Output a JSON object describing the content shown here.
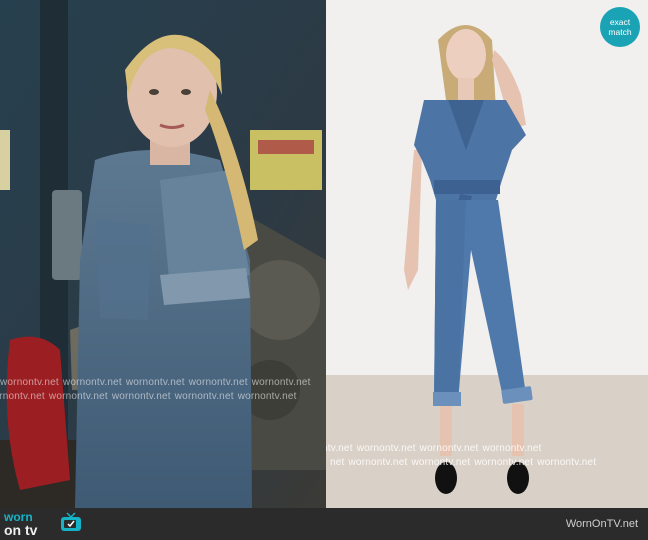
{
  "left_image": {
    "description": "Betty Cooper in denim jumpsuit with grey long-sleeve underneath, garage background"
  },
  "right_image": {
    "description": "Model wearing short-sleeve belted denim jumpsuit with cuffed legs and black slide sandals"
  },
  "badge": {
    "line1": "exact",
    "line2": "match"
  },
  "watermarks": {
    "left_row1": [
      "wornontv.net",
      "wornontv.net",
      "wornontv.net",
      "wornontv.net",
      "wornontv.net"
    ],
    "left_row2": [
      "wornontv.net",
      "wornontv.net",
      "wornontv.net",
      "wornontv.net",
      "wornontv.net"
    ],
    "right_row1": [
      "ntv.net",
      "wornontv.net",
      "wornontv.net",
      "wornontv.net"
    ],
    "right_row2": [
      "net",
      "wornontv.net",
      "wornontv.net",
      "wornontv.net",
      "wornontv.net"
    ]
  },
  "footer": {
    "logo_top": "worn",
    "logo_bottom": "on tv",
    "site": "WornOnTV.net"
  },
  "colors": {
    "brand_teal": "#15b3c8",
    "badge_teal": "#1aa3b5",
    "footer_bg": "#2b2b2b",
    "denim": "#4a6f9a"
  }
}
